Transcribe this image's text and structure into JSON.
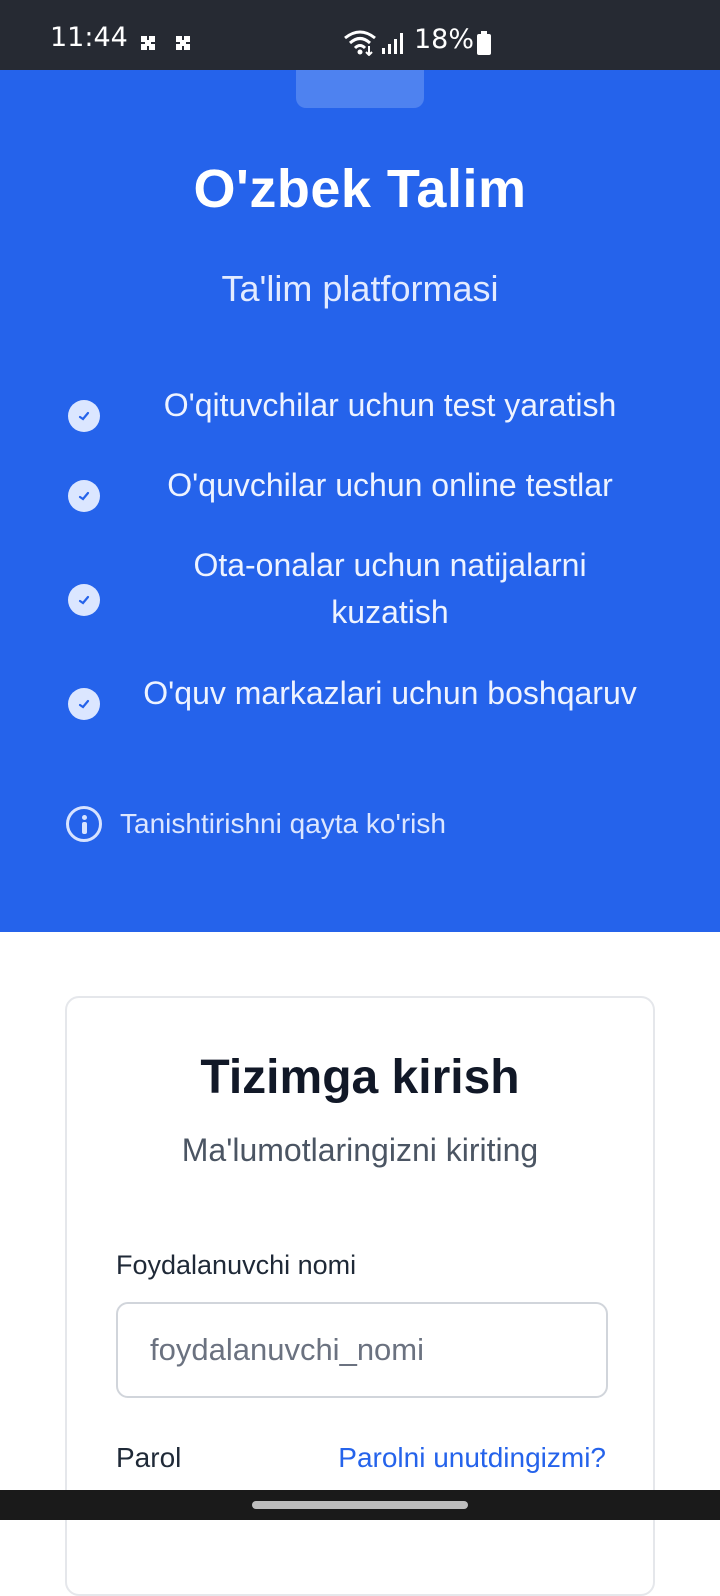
{
  "status_bar": {
    "time": "11:44",
    "battery_text": "18%",
    "icons": [
      "notification-icon",
      "notification-icon",
      "wifi-icon",
      "signal-icon",
      "battery-icon"
    ]
  },
  "hero": {
    "title": "O'zbek Talim",
    "subtitle": "Ta'lim platformasi",
    "features": [
      {
        "label": "O'qituvchilar uchun test yaratish",
        "icon": "check-circle-icon"
      },
      {
        "label": "O'quvchilar uchun online testlar",
        "icon": "check-circle-icon"
      },
      {
        "label": "Ota-onalar uchun natijalarni kuzatish",
        "icon": "check-circle-icon"
      },
      {
        "label": "O'quv markazlari uchun boshqaruv",
        "icon": "check-circle-icon"
      }
    ],
    "intro_link": {
      "label": "Tanishtirishni qayta ko'rish",
      "icon": "info-icon"
    },
    "colors": {
      "background": "#2563eb",
      "text": "#ffffff"
    }
  },
  "login": {
    "title": "Tizimga kirish",
    "subtitle": "Ma'lumotlaringizni kiriting",
    "username_label": "Foydalanuvchi nomi",
    "username_value": "",
    "username_placeholder": "foydalanuvchi_nomi",
    "password_label": "Parol",
    "forgot_password": "Parolni unutdingizmi?",
    "colors": {
      "link": "#2563eb",
      "title": "#111827"
    }
  }
}
